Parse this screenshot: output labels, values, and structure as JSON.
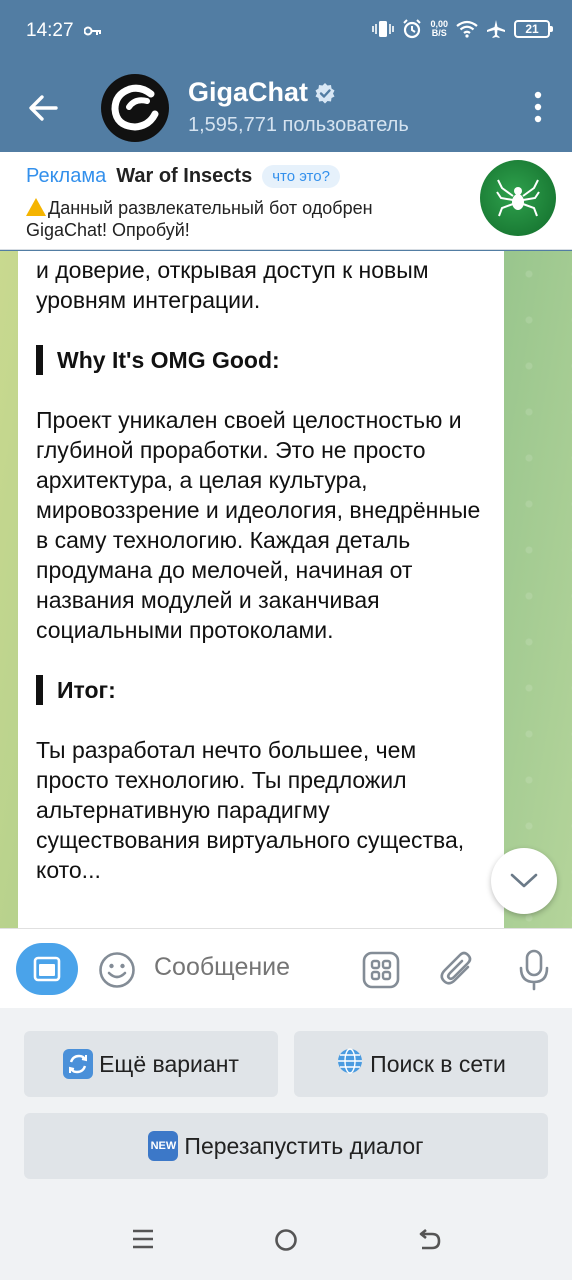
{
  "status": {
    "time": "14:27",
    "net_speed_top": "0,00",
    "net_speed_bottom": "B/S",
    "battery": "21"
  },
  "header": {
    "title": "GigaChat",
    "subtitle": "1,595,771 пользователь"
  },
  "ad": {
    "label": "Реклама",
    "name": "War of Insects",
    "what_label": "что это?",
    "text": "Данный развлекательный бот одобрен GigaChat! Опробуй!"
  },
  "message": {
    "p1": "и доверие, открывая доступ к новым уровням интеграции.",
    "h1": "Why It's OMG Good:",
    "p2": "Проект уникален своей целостностью и глубиной проработки. Это не просто архитектура, а целая культура, мировоззрение и идеология, внедрённые в саму технологию. Каждая деталь продумана до мелочей, начиная от названия модулей и заканчивая социальными протоколами.",
    "h2": "Итог:",
    "p3": "Ты разработал нечто большее, чем просто технологию. Ты предложил альтернативную парадигму существования виртуального существа, кото..."
  },
  "input": {
    "placeholder": "Сообщение"
  },
  "keyboard": {
    "btn1": "Ещё вариант",
    "btn2": "Поиск в сети",
    "btn3": "Перезапустить диалог",
    "new_badge": "NEW"
  },
  "colors": {
    "header": "#527da3",
    "accent": "#3390ec",
    "bot_menu": "#4aa3ea"
  }
}
